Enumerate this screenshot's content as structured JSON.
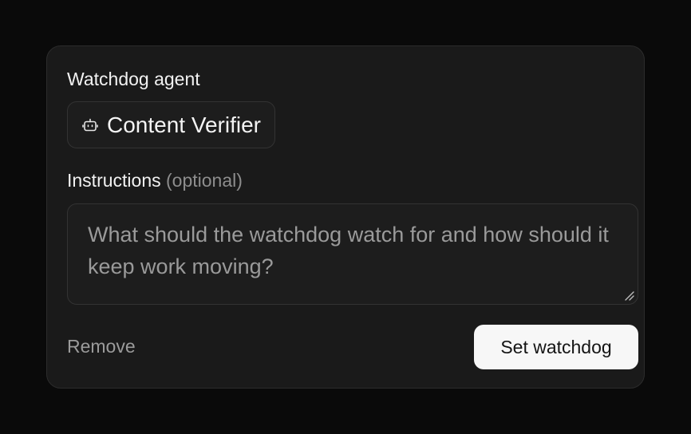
{
  "panel": {
    "agent_label": "Watchdog agent",
    "agent_chip": {
      "icon": "robot-icon",
      "name": "Content Verifier"
    },
    "instructions_label": "Instructions",
    "instructions_optional": "(optional)",
    "instructions_value": "",
    "instructions_placeholder": "What should the watchdog watch for and how should it keep work moving?",
    "remove_label": "Remove",
    "submit_label": "Set watchdog"
  },
  "colors": {
    "background": "#0a0a0a",
    "card": "#1a1a1a",
    "border": "#2c2c2c",
    "primary_button": "#f7f7f7",
    "muted_text": "#9b9b9b"
  }
}
